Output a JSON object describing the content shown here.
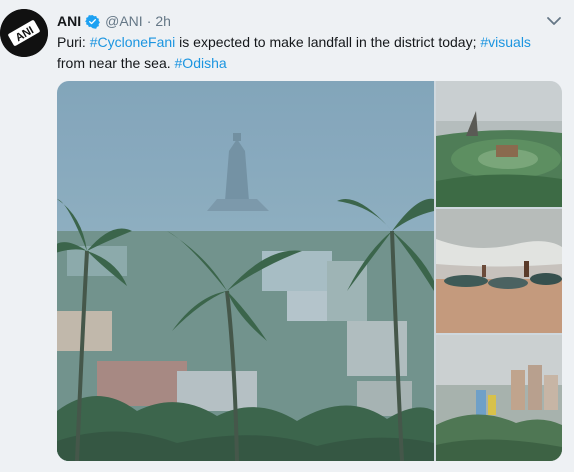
{
  "tweet": {
    "author_name": "ANI",
    "handle": "@ANI",
    "separator": "·",
    "time": "2h",
    "text_parts": [
      {
        "text": "Puri: ",
        "hashtag": false
      },
      {
        "text": "#CycloneFani",
        "hashtag": true
      },
      {
        "text": " is expected to make landfall in the district today; ",
        "hashtag": false
      },
      {
        "text": "#visuals",
        "hashtag": true
      },
      {
        "text": " from near the sea. ",
        "hashtag": false
      },
      {
        "text": "#Odisha",
        "hashtag": true
      }
    ],
    "avatar_logo_text": "ANI"
  },
  "colors": {
    "link": "#1b95e0",
    "text": "#14171a",
    "muted": "#657786",
    "background": "#eef1f4",
    "verified": "#1da1f2"
  },
  "icons": {
    "verified": "verified-badge-icon",
    "caret": "chevron-down-icon"
  }
}
